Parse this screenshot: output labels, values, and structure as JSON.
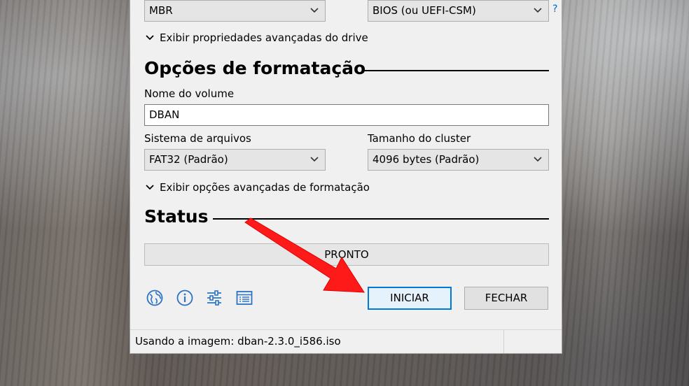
{
  "drive": {
    "partition_scheme": "MBR",
    "target_system": "BIOS (ou UEFI-CSM)",
    "help_glyph": "?",
    "advanced_drive_label": "Exibir propriedades avançadas do drive"
  },
  "format": {
    "section_title": "Opções de formatação",
    "volume_label_caption": "Nome do volume",
    "volume_label_value": "DBAN",
    "filesystem_caption": "Sistema de arquivos",
    "filesystem_value": "FAT32 (Padrão)",
    "cluster_caption": "Tamanho do cluster",
    "cluster_value": "4096 bytes (Padrão)",
    "advanced_format_label": "Exibir opções avançadas de formatação"
  },
  "status": {
    "section_title": "Status",
    "progress_text": "PRONTO"
  },
  "toolbar": {
    "icons": [
      "globe-icon",
      "info-icon",
      "settings-sliders-icon",
      "log-icon"
    ]
  },
  "actions": {
    "start_label": "INICIAR",
    "close_label": "FECHAR"
  },
  "statusbar": {
    "text": "Usando a imagem: dban-2.3.0_i586.iso"
  },
  "colors": {
    "accent": "#0078d7",
    "annotation_arrow": "#ff1a1a"
  }
}
